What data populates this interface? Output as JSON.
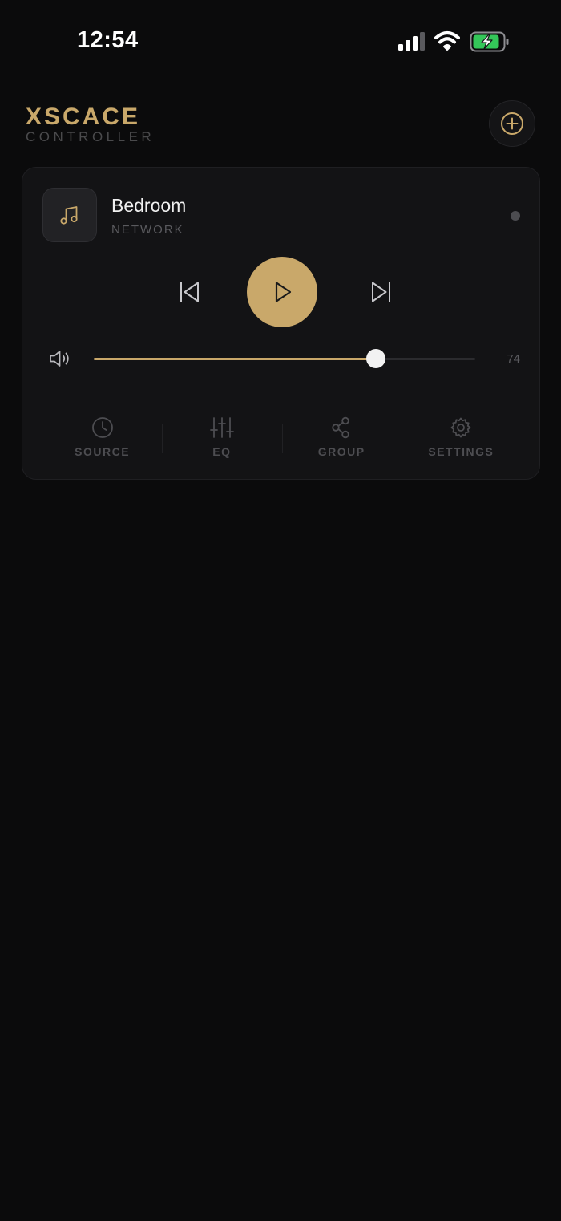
{
  "status_bar": {
    "time": "12:54",
    "icons": [
      "signal-icon",
      "wifi-icon",
      "battery-charging-icon"
    ]
  },
  "header": {
    "brand_name": "XSCACE",
    "brand_subtitle": "CONTROLLER",
    "add_icon": "plus-circle-icon"
  },
  "device": {
    "name": "Bedroom",
    "source": "NETWORK",
    "art_icon": "music-note-icon",
    "status": "offline",
    "volume": 74,
    "volume_fraction": 0.74,
    "controls": [
      "skip-previous-icon",
      "play-icon",
      "skip-next-icon"
    ]
  },
  "nav": {
    "items": [
      {
        "label": "SOURCE",
        "icon": "clock-icon"
      },
      {
        "label": "EQ",
        "icon": "sliders-icon"
      },
      {
        "label": "GROUP",
        "icon": "share-icon"
      },
      {
        "label": "SETTINGS",
        "icon": "gear-icon"
      }
    ]
  },
  "colors": {
    "accent": "#c9a86a",
    "background": "#0b0b0c",
    "card": "#131315",
    "muted_text": "#5a5a5e",
    "battery_green": "#34c759"
  }
}
